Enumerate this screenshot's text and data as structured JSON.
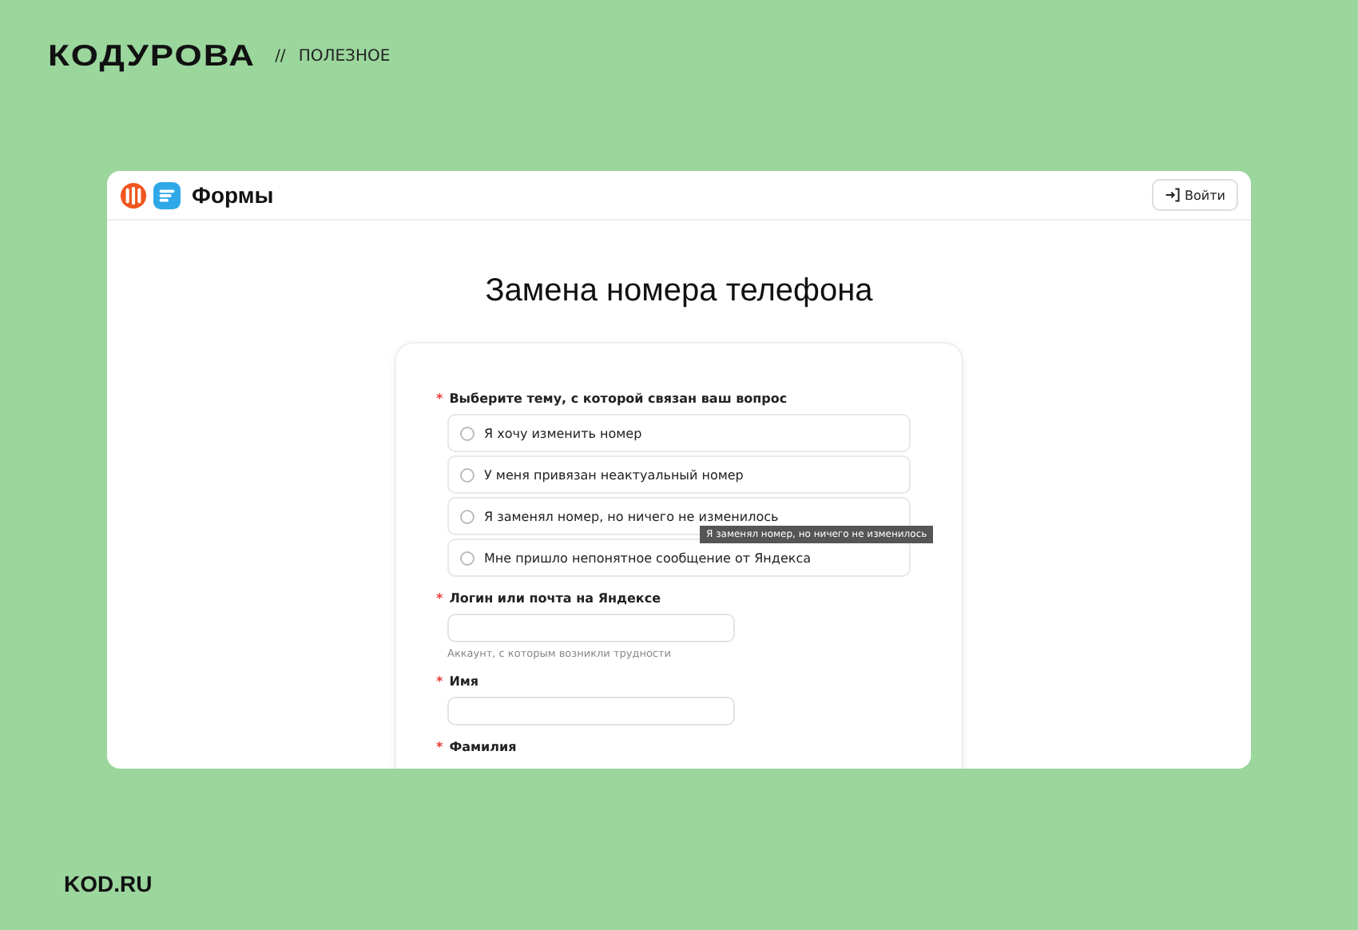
{
  "brand": {
    "logo": "КОДУРОВА",
    "separator": "//",
    "section": "ПОЛЕЗНОЕ"
  },
  "browser": {
    "app_name": "Формы",
    "login_button": "Войти",
    "form_title": "Замена номера телефона",
    "questions": [
      {
        "kind": "radio",
        "required_mark": "*",
        "label": "Выберите тему, с которой связан ваш вопрос",
        "options": [
          {
            "label": "Я хочу изменить номер",
            "selected": false
          },
          {
            "label": "У меня привязан неактуальный номер",
            "selected": false
          },
          {
            "label": "Я заменял номер, но ничего не изменилось",
            "selected": false
          },
          {
            "label": "Мне пришло непонятное сообщение от Яндекса",
            "selected": false
          }
        ]
      },
      {
        "kind": "text",
        "required_mark": "*",
        "label": "Логин или почта на Яндексе",
        "hint": "Аккаунт, с которым возникли трудности"
      },
      {
        "kind": "text",
        "required_mark": "*",
        "label": "Имя"
      },
      {
        "kind": "label",
        "required_mark": "*",
        "label": "Фамилия"
      }
    ],
    "tooltip": "Я заменял номер, но ничего не изменилось"
  },
  "footer": "KOD.RU"
}
